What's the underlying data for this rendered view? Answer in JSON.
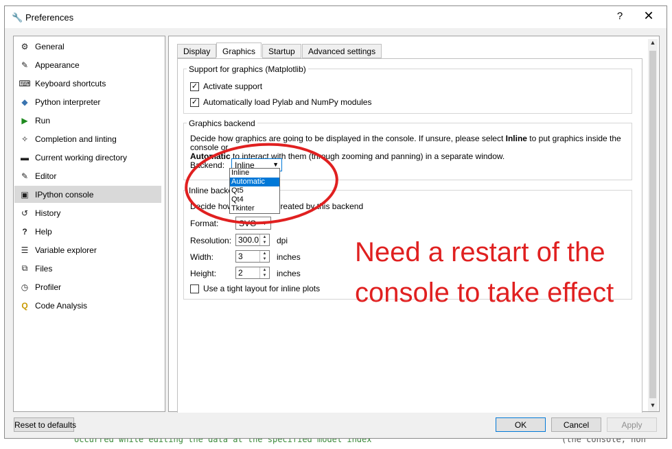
{
  "window": {
    "title": "Preferences",
    "help": "?",
    "close": "✕"
  },
  "sidebar": {
    "items": [
      {
        "label": "General",
        "icon": "gears-icon",
        "glyph": "⚙"
      },
      {
        "label": "Appearance",
        "icon": "eyedropper-icon",
        "glyph": "✎"
      },
      {
        "label": "Keyboard shortcuts",
        "icon": "keyboard-icon",
        "glyph": "⌨"
      },
      {
        "label": "Python interpreter",
        "icon": "python-icon",
        "glyph": "◆"
      },
      {
        "label": "Run",
        "icon": "play-icon",
        "glyph": "▶"
      },
      {
        "label": "Completion and linting",
        "icon": "puzzle-icon",
        "glyph": "✧"
      },
      {
        "label": "Current working directory",
        "icon": "folder-icon",
        "glyph": "▬"
      },
      {
        "label": "Editor",
        "icon": "edit-icon",
        "glyph": "✎"
      },
      {
        "label": "IPython console",
        "icon": "terminal-icon",
        "glyph": "▣"
      },
      {
        "label": "History",
        "icon": "history-icon",
        "glyph": "↺"
      },
      {
        "label": "Help",
        "icon": "question-icon",
        "glyph": "?"
      },
      {
        "label": "Variable explorer",
        "icon": "table-icon",
        "glyph": "☰"
      },
      {
        "label": "Files",
        "icon": "files-icon",
        "glyph": "⧉"
      },
      {
        "label": "Profiler",
        "icon": "clock-icon",
        "glyph": "◷"
      },
      {
        "label": "Code Analysis",
        "icon": "code-analysis-icon",
        "glyph": "Q"
      }
    ],
    "selected": "IPython console"
  },
  "tabs": [
    "Display",
    "Graphics",
    "Startup",
    "Advanced settings"
  ],
  "active_tab": "Graphics",
  "support_group": {
    "title": "Support for graphics (Matplotlib)",
    "activate_label": "Activate support",
    "activate_checked": true,
    "autoload_label": "Automatically load Pylab and NumPy modules",
    "autoload_checked": true
  },
  "backend_group": {
    "title": "Graphics backend",
    "desc_1": "Decide how graphics are going to be displayed in the console. If unsure, please select ",
    "desc_bold_1": "Inline",
    "desc_2": " to put graphics inside the console or",
    "desc_bold_2": "Automatic",
    "desc_3": " to interact with them (through zooming and panning) in a separate window.",
    "backend_label": "Backend:",
    "backend_value": "Inline",
    "options": [
      "Inline",
      "Automatic",
      "Qt5",
      "Qt4",
      "Tkinter"
    ],
    "highlighted_option": "Automatic"
  },
  "inline_group": {
    "title": "Inline backend",
    "desc": "Decide how the figures created by this backend",
    "format_label": "Format:",
    "format_value": "SVG",
    "resolution_label": "Resolution:",
    "resolution_value": "300.0",
    "resolution_unit": "dpi",
    "width_label": "Width:",
    "width_value": "3",
    "width_unit": "inches",
    "height_label": "Height:",
    "height_value": "2",
    "height_unit": "inches",
    "tight_label": "Use a tight layout for inline plots",
    "tight_checked": false
  },
  "buttons": {
    "reset": "Reset to defaults",
    "ok": "OK",
    "cancel": "Cancel",
    "apply": "Apply"
  },
  "annotation": "Need a restart of the console to take effect",
  "background_code": {
    "left": "occurred while editing the data at the specified model index",
    "right": "(the console; non"
  },
  "colors": {
    "annotation": "#e02020",
    "selection": "#0078d7",
    "sidebar_selected": "#d9d9d9"
  }
}
